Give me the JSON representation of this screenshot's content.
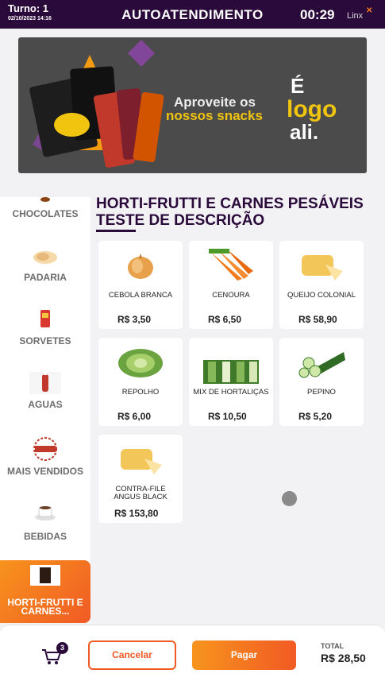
{
  "header": {
    "turno": "Turno: 1",
    "datetime": "02/10/2023 14:16",
    "title": "AUTOATENDIMENTO",
    "timer": "00:29",
    "brand": "Linx"
  },
  "banner": {
    "promo_line1": "Aproveite os",
    "promo_line2": "nossos snacks",
    "big_line1": "É",
    "big_line2": "logo",
    "big_line3": "ali."
  },
  "sidebar": {
    "items": [
      {
        "label": "CHOCOLATES",
        "icon": "chocolate-icon"
      },
      {
        "label": "PADARIA",
        "icon": "bread-icon"
      },
      {
        "label": "SORVETES",
        "icon": "ice-cream-icon"
      },
      {
        "label": "AGUAS",
        "icon": "water-bottle-icon"
      },
      {
        "label": "MAIS VENDIDOS",
        "icon": "best-seller-badge-icon"
      },
      {
        "label": "BEBIDAS",
        "icon": "coffee-cup-icon"
      },
      {
        "label": "HORTI-FRUTTI E CARNES...",
        "icon": "drink-glass-icon",
        "active": true
      }
    ]
  },
  "section": {
    "title": "HORTI-FRUTTI E CARNES PESÁVEIS TESTE DE DESCRIÇÃO"
  },
  "products": [
    {
      "name": "CEBOLA BRANCA",
      "price": "R$ 3,50"
    },
    {
      "name": "CENOURA",
      "price": "R$ 6,50"
    },
    {
      "name": "QUEIJO COLONIAL",
      "price": "R$ 58,90"
    },
    {
      "name": "REPOLHO",
      "price": "R$ 6,00"
    },
    {
      "name": "MIX DE HORTALIÇAS",
      "price": "R$ 10,50"
    },
    {
      "name": "PEPINO",
      "price": "R$ 5,20"
    },
    {
      "name": "CONTRA-FILE ANGUS BLACK",
      "price": "R$ 153,80"
    }
  ],
  "footer": {
    "cart_count": "3",
    "cancel_label": "Cancelar",
    "pay_label": "Pagar",
    "total_label": "TOTAL",
    "total_value": "R$ 28,50"
  },
  "colors": {
    "header_bg": "#2a0a3a",
    "accent": "#f15a24",
    "accent_light": "#f7941d"
  }
}
